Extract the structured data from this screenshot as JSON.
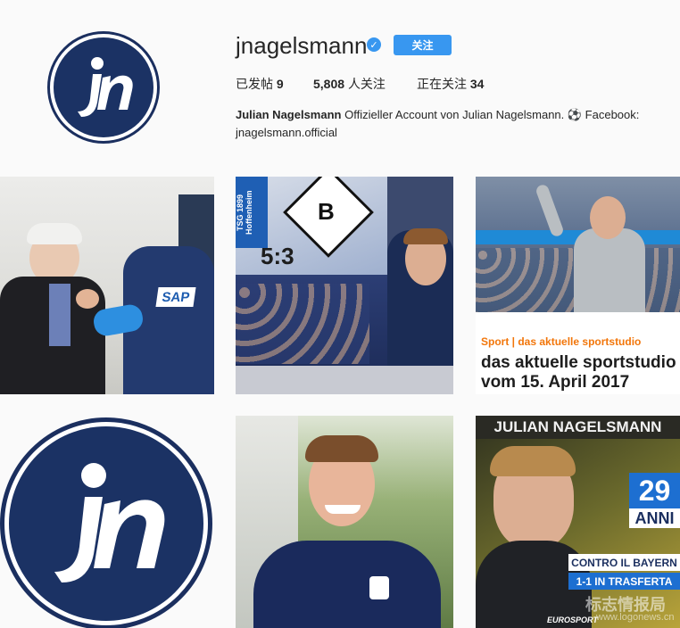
{
  "profile": {
    "username": "jnagelsmann",
    "follow_label": "关注",
    "stats": {
      "posts_label": "已发帖",
      "posts_count": "9",
      "followers_count": "5,808",
      "followers_label": "人关注",
      "following_label": "正在关注",
      "following_count": "34"
    },
    "bio_name": "Julian Nagelsmann",
    "bio_text": " Offizieller Account von Julian Nagelsmann. ⚽ Facebook: jnagelsmann.official"
  },
  "posts": {
    "p2_score": "5:3",
    "p2_club": "TSG 1899 Hoffenheim",
    "p2_sap": "SAP",
    "p3_brand": "Sport | das aktuelle sportstudio",
    "p3_title_line1": "das aktuelle sportstudio",
    "p3_title_line2": "vom 15. April 2017",
    "p6_banner": "JULIAN NAGELSMANN",
    "p6_age_number": "29",
    "p6_age_label": "ANNI",
    "p6_line1": "CONTRO IL BAYERN",
    "p6_line2": "1-1 IN TRASFERTA",
    "p6_source": "EUROSPORT"
  },
  "watermark": {
    "cn_text": "标志情报局",
    "url_text": "www.logonews.cn"
  },
  "colors": {
    "accent": "#3897f0",
    "navy": "#1b3264",
    "brand_orange": "#f2760a"
  }
}
